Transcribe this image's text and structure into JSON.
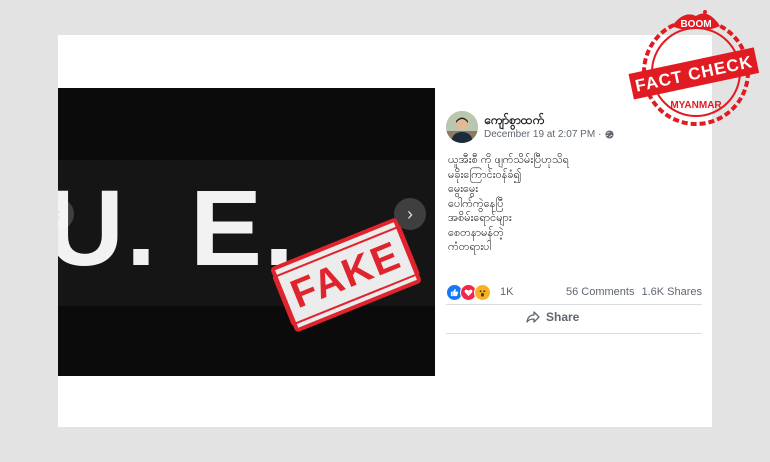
{
  "post": {
    "author": "ကျော်စွာထက်",
    "date": "December 19 at 2:07 PM",
    "separator": "·",
    "text_lines": [
      "ယူအီးစီ ကို ဖျက်သိမ်းပြီဟုသိရ",
      "မခိုးကြောင်းဝန်ခံ၍",
      "မွေးမွေး",
      "ပေါက်ကွဲနေပြီ",
      "အစိမ်းရောင်များ",
      "စေတနာမန်တဲ့",
      "ကံတရားပါ"
    ]
  },
  "media": {
    "overlay_text": "U. E.",
    "stamp_label": "FAKE",
    "prev_arrow": "‹",
    "next_arrow": "›"
  },
  "stats": {
    "reactions_count": "1K",
    "comments": "56 Comments",
    "shares": "1.6K Shares"
  },
  "actions": {
    "share_label": "Share"
  },
  "badge": {
    "top": "BOOM",
    "main": "FACT CHECK",
    "bottom": "MYANMAR"
  },
  "colors": {
    "fake_red": "#e0242e",
    "badge_red": "#e11b22",
    "fb_blue": "#1877f2"
  }
}
